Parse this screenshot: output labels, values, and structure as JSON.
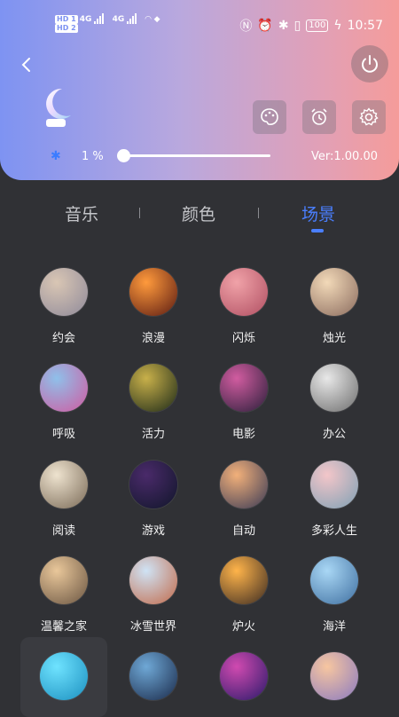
{
  "status_bar": {
    "hd1": "HD 1",
    "hd2": "HD 2",
    "net1": "4G",
    "net2": "4G",
    "battery": "100",
    "time": "10:57"
  },
  "controls": {
    "brightness_text": "1 %",
    "brightness_value": 1,
    "version_text": "Ver:1.00.00"
  },
  "tabs": [
    {
      "label": "音乐"
    },
    {
      "label": "颜色"
    },
    {
      "label": "场景"
    }
  ],
  "scenes": [
    {
      "label": "约会",
      "colors": [
        "#d9c6b4",
        "#8f8a9a"
      ]
    },
    {
      "label": "浪漫",
      "colors": [
        "#ff9a3c",
        "#5a1a12"
      ]
    },
    {
      "label": "闪烁",
      "colors": [
        "#f0a2a8",
        "#b04f62"
      ]
    },
    {
      "label": "烛光",
      "colors": [
        "#f2d9b8",
        "#8a6b5e"
      ]
    },
    {
      "label": "呼吸",
      "colors": [
        "#8fc0ea",
        "#d05aa0"
      ]
    },
    {
      "label": "活力",
      "colors": [
        "#c8b04a",
        "#1d2a18"
      ]
    },
    {
      "label": "电影",
      "colors": [
        "#d15ca0",
        "#2a1f3a"
      ]
    },
    {
      "label": "办公",
      "colors": [
        "#e8e8e8",
        "#6d6d6d"
      ]
    },
    {
      "label": "阅读",
      "colors": [
        "#eee3cf",
        "#7a6a57"
      ]
    },
    {
      "label": "游戏",
      "colors": [
        "#4a2a6a",
        "#10162a"
      ]
    },
    {
      "label": "自动",
      "colors": [
        "#f2b07a",
        "#3a3a55"
      ]
    },
    {
      "label": "多彩人生",
      "colors": [
        "#f3c6c9",
        "#7fa0b4"
      ]
    },
    {
      "label": "温馨之家",
      "colors": [
        "#e9c79a",
        "#6a5542"
      ]
    },
    {
      "label": "冰雪世界",
      "colors": [
        "#cfe3f5",
        "#c26a4a"
      ]
    },
    {
      "label": "炉火",
      "colors": [
        "#ffb44a",
        "#3a2a22"
      ]
    },
    {
      "label": "海洋",
      "colors": [
        "#a9d7f5",
        "#3f6fa0"
      ]
    },
    {
      "label": "",
      "colors": [
        "#6fe3ff",
        "#1b8fbf"
      ]
    },
    {
      "label": "",
      "colors": [
        "#6fa8d6",
        "#1a2a4a"
      ]
    },
    {
      "label": "",
      "colors": [
        "#d04ab0",
        "#2a1a6a"
      ]
    },
    {
      "label": "",
      "colors": [
        "#f7c6a0",
        "#8a7ac0"
      ]
    }
  ]
}
